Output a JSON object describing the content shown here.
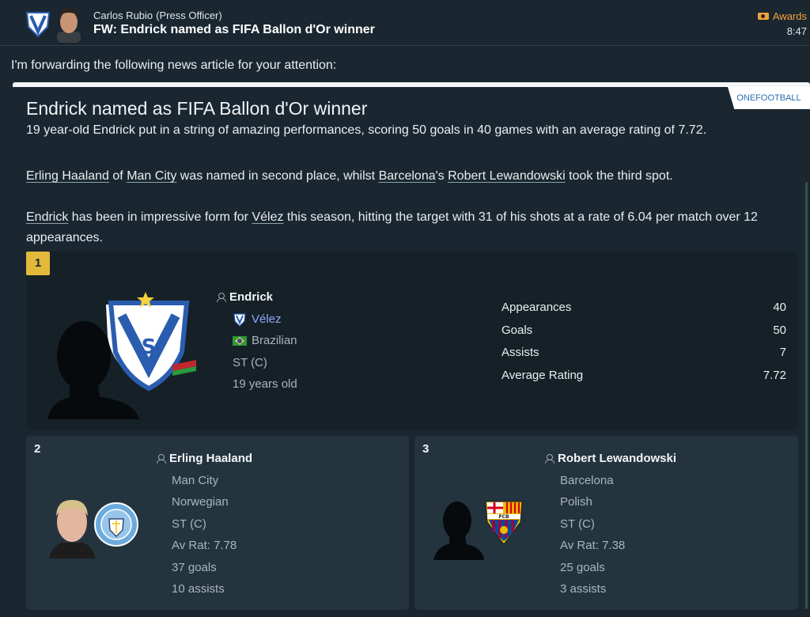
{
  "header": {
    "sender_name": "Carlos Rubio",
    "sender_role": "(Press Officer)",
    "subject": "FW: Endrick named as FIFA Ballon d'Or winner",
    "category": "Awards",
    "time": "8:47"
  },
  "intro": "I'm forwarding the following news article for your attention:",
  "article": {
    "title": "Endrick named as FIFA Ballon d'Or winner",
    "source": "ONEFOOTBALL",
    "paragraph1": "19 year-old Endrick put in a string of amazing performances, scoring 50 goals in 40 games with an average rating of 7.72.",
    "paragraph2": {
      "p1": "Erling Haaland",
      "t1": " of ",
      "p2": "Man City",
      "t2": " was named in second place, whilst ",
      "p3": "Barcelona",
      "t3": "'s ",
      "p4": "Robert Lewandowski",
      "t4": " took the third spot."
    },
    "paragraph3": {
      "p1": "Endrick",
      "t1": " has been in impressive form for ",
      "p2": "Vélez",
      "t2": " this season, hitting the target with 31 of his shots at a rate of 6.04 per match over 12 appearances."
    }
  },
  "winner": {
    "rank": "1",
    "name": "Endrick",
    "club": "Vélez",
    "nationality": "Brazilian",
    "position": "ST (C)",
    "age": "19 years old",
    "stats": [
      {
        "label": "Appearances",
        "value": "40"
      },
      {
        "label": "Goals",
        "value": "50"
      },
      {
        "label": "Assists",
        "value": "7"
      },
      {
        "label": "Average Rating",
        "value": "7.72"
      }
    ]
  },
  "runners_up": [
    {
      "rank": "2",
      "name": "Erling Haaland",
      "club": "Man City",
      "nationality": "Norwegian",
      "position": "ST (C)",
      "rating": "Av Rat: 7.78",
      "goals": "37 goals",
      "assists": "10 assists"
    },
    {
      "rank": "3",
      "name": "Robert Lewandowski",
      "club": "Barcelona",
      "nationality": "Polish",
      "position": "ST (C)",
      "rating": "Av Rat: 7.38",
      "goals": "25 goals",
      "assists": "3 assists"
    }
  ],
  "colors": {
    "background": "#1a2730",
    "winner_card": "#162127",
    "runner_card": "#24343e",
    "rank_badge": "#e2b93a",
    "awards_accent": "#f4a23a",
    "club_link": "#8fa6ff"
  }
}
